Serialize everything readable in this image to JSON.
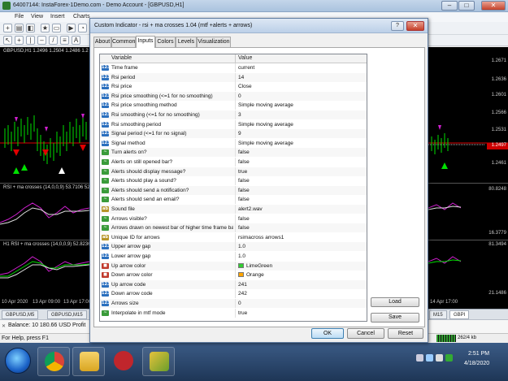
{
  "mt4": {
    "title": "64007144: InstaForex-1Demo.com - Demo Account - [GBPUSD,H1]",
    "menu": [
      "File",
      "View",
      "Insert",
      "Charts"
    ],
    "main_chart_label": "GBPUSD,H1  1.2496 1.2504 1.2486 1.2",
    "rsi1_label": "RSI + ma crosses (14,0,0,9) 53.7106 52.",
    "rsi2_label": "H1 RSI + ma crosses (14,0,0,9) 52.8236",
    "price_labels": [
      "1.2671",
      "1.2636",
      "1.2601",
      "1.2566",
      "1.2531",
      "1.2497",
      "1.2461"
    ],
    "rsi_labels": [
      "80.8248",
      "16.3779",
      "81.3494",
      "21.1486"
    ],
    "time_labels": [
      "10 Apr 2020",
      "13 Apr 09:00",
      "13 Apr 17:00"
    ],
    "right_time_label": "14 Apr 17:00",
    "chart_tabs": [
      "GBPUSD,M5",
      "GBPUSD,M15",
      "M15",
      "GBPI"
    ],
    "balance": "Balance: 10 180.66 USD  Profit",
    "status_help": "For Help, press F1",
    "status_kb": "262/4 kb"
  },
  "taskbar": {
    "time": "2:51 PM",
    "date": "4/18/2020"
  },
  "dialog": {
    "title": "Custom Indicator - rsi + ma crosses 1.04 (mtf +alerts + arrows)",
    "help_label": "?",
    "close_label": "✕",
    "tabs": [
      "About",
      "Common",
      "Inputs",
      "Colors",
      "Levels",
      "Visualization"
    ],
    "grid_headers": {
      "variable": "Variable",
      "value": "Value"
    },
    "rows": [
      {
        "name": "Time frame",
        "value": "current",
        "kind": "enm",
        "icon": "123"
      },
      {
        "name": "Rsi period",
        "value": "14",
        "kind": "num",
        "icon": "123"
      },
      {
        "name": "Rsi price",
        "value": "Close",
        "kind": "enm",
        "icon": "123"
      },
      {
        "name": "Rsi price smoothing (<=1 for no smoothing)",
        "value": "0",
        "kind": "num",
        "icon": "123"
      },
      {
        "name": "Rsi price smoothing method",
        "value": "Simple moving average",
        "kind": "enm",
        "icon": "123"
      },
      {
        "name": "Rsi smoothing (<=1 for no smoothing)",
        "value": "3",
        "kind": "num",
        "icon": "123"
      },
      {
        "name": "Rsi smoothing period",
        "value": "Simple moving average",
        "kind": "enm",
        "icon": "123"
      },
      {
        "name": "Signal period (<=1 for no signal)",
        "value": "9",
        "kind": "num",
        "icon": "123"
      },
      {
        "name": "Signal method",
        "value": "Simple moving average",
        "kind": "enm",
        "icon": "123"
      },
      {
        "name": "Turn alerts on?",
        "value": "false",
        "kind": "bool",
        "icon": "~"
      },
      {
        "name": "Alerts on still opened bar?",
        "value": "false",
        "kind": "bool",
        "icon": "~"
      },
      {
        "name": "Alerts should display message?",
        "value": "true",
        "kind": "bool",
        "icon": "~"
      },
      {
        "name": "Alerts should play a sound?",
        "value": "false",
        "kind": "bool",
        "icon": "~"
      },
      {
        "name": "Alerts should send a notification?",
        "value": "false",
        "kind": "bool",
        "icon": "~"
      },
      {
        "name": "Alerts should send an email?",
        "value": "false",
        "kind": "bool",
        "icon": "~"
      },
      {
        "name": "Sound file",
        "value": "alert2.wav",
        "kind": "str",
        "icon": "ab"
      },
      {
        "name": "Arrows visible?",
        "value": "false",
        "kind": "bool",
        "icon": "~"
      },
      {
        "name": "Arrows drawn on newest bar of higher time frame bar?",
        "value": "false",
        "kind": "bool",
        "icon": "~"
      },
      {
        "name": "Unique ID for arrows",
        "value": "rsimacross arrows1",
        "kind": "str",
        "icon": "ab"
      },
      {
        "name": "Upper arrow gap",
        "value": "1.0",
        "kind": "num",
        "icon": "123"
      },
      {
        "name": "Lower arrow gap",
        "value": "1.0",
        "kind": "num",
        "icon": "123"
      },
      {
        "name": "Up arrow color",
        "value": "LimeGreen",
        "kind": "clr",
        "icon": "■",
        "swatch": "#32cd32"
      },
      {
        "name": "Down arrow color",
        "value": "Orange",
        "kind": "clr",
        "icon": "■",
        "swatch": "#ffa500"
      },
      {
        "name": "Up arrow code",
        "value": "241",
        "kind": "num",
        "icon": "123"
      },
      {
        "name": "Down arrow code",
        "value": "242",
        "kind": "num",
        "icon": "123"
      },
      {
        "name": "Arrows size",
        "value": "0",
        "kind": "num",
        "icon": "123"
      },
      {
        "name": "Interpolate in mtf mode",
        "value": "true",
        "kind": "bool",
        "icon": "~"
      }
    ],
    "buttons": {
      "load": "Load",
      "save": "Save",
      "ok": "OK",
      "cancel": "Cancel",
      "reset": "Reset"
    }
  }
}
